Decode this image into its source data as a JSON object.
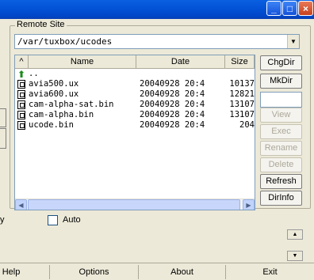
{
  "window": {
    "minimize": "_",
    "maximize": "□",
    "close": "×"
  },
  "remote_site": {
    "group_label": "Remote Site",
    "path": "/var/tuxbox/ucodes",
    "columns": {
      "sort": "^",
      "name": "Name",
      "date": "Date",
      "size": "Size"
    },
    "files": [
      {
        "name": "..",
        "date": "",
        "size": "",
        "icon": "up-folder-icon"
      },
      {
        "name": "avia500.ux",
        "date": "20040928 20:4",
        "size": "10137",
        "icon": "file-icon"
      },
      {
        "name": "avia600.ux",
        "date": "20040928 20:4",
        "size": "12821",
        "icon": "file-icon"
      },
      {
        "name": "cam-alpha-sat.bin",
        "date": "20040928 20:4",
        "size": "13107",
        "icon": "file-icon"
      },
      {
        "name": "cam-alpha.bin",
        "date": "20040928 20:4",
        "size": "13107",
        "icon": "file-icon"
      },
      {
        "name": "ucode.bin",
        "date": "20040928 20:4",
        "size": "204",
        "icon": "file-icon"
      }
    ]
  },
  "buttons": {
    "chgdir": "ChgDir",
    "mkdir": "MkDir",
    "view": "View",
    "exec": "Exec",
    "rename": "Rename",
    "delete": "Delete",
    "refresh": "Refresh",
    "dirinfo": "DirInfo"
  },
  "auto": {
    "left_fragment": "y",
    "label": "Auto",
    "checked": false
  },
  "bottom": {
    "help": "Help",
    "options": "Options",
    "about": "About",
    "exit": "Exit"
  }
}
